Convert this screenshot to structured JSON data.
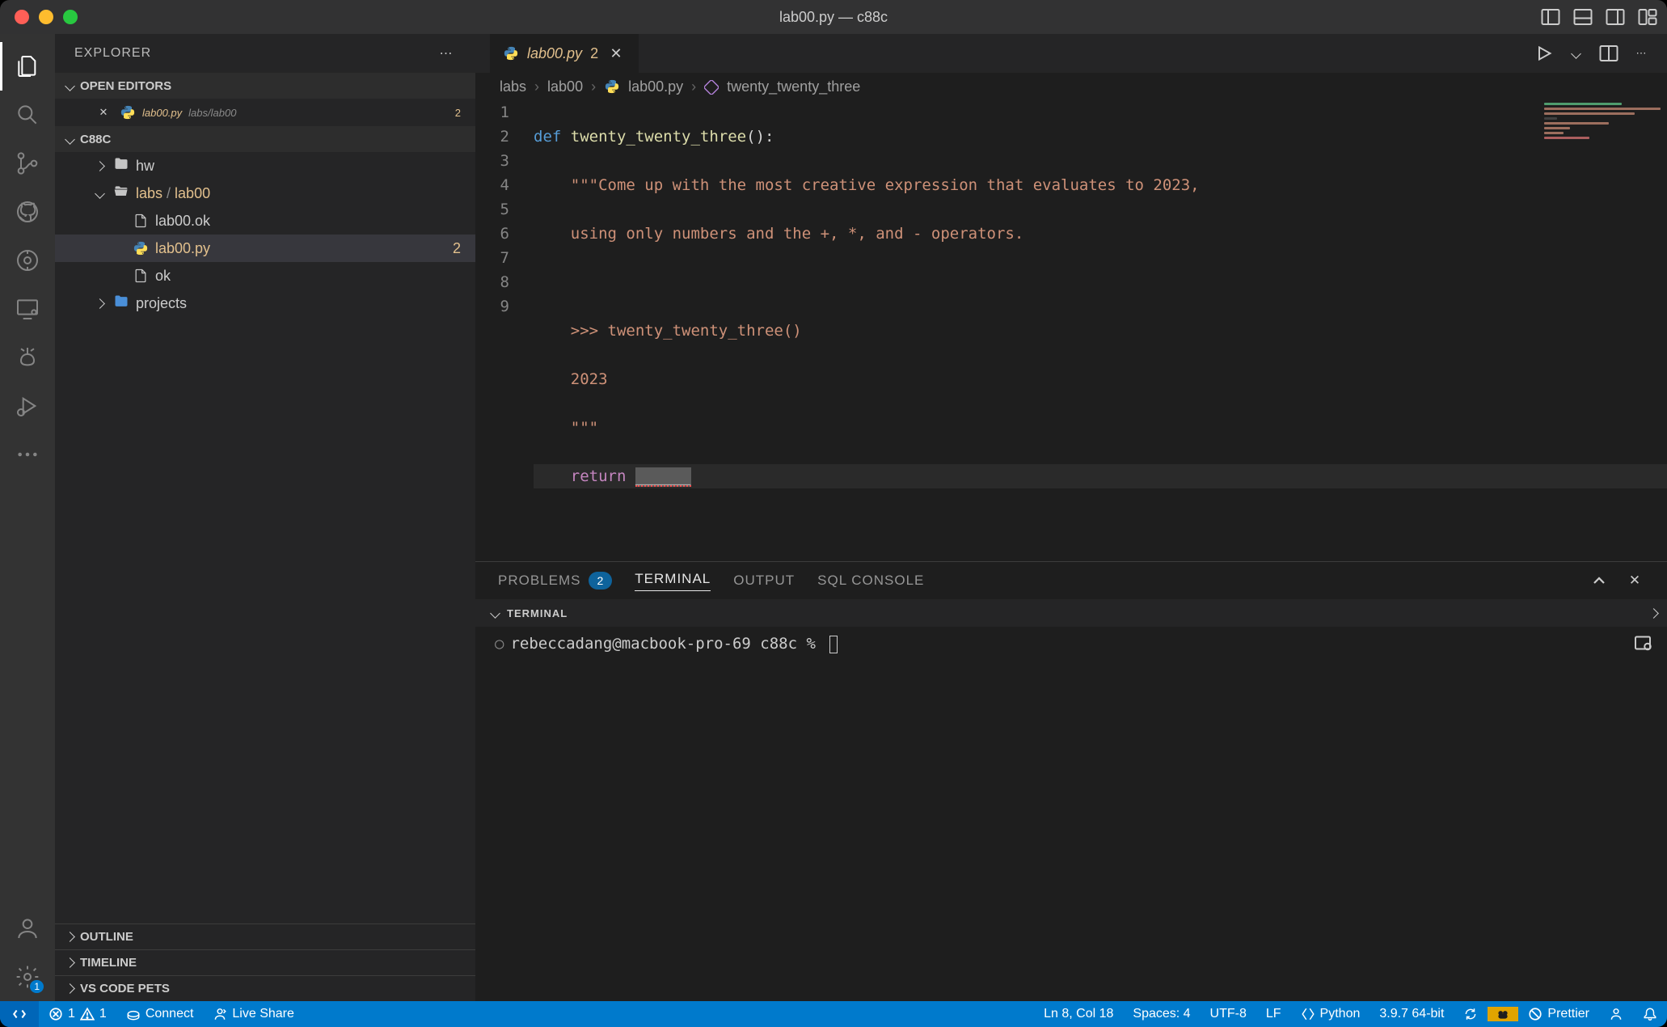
{
  "window": {
    "title": "lab00.py — c88c"
  },
  "sidebar": {
    "title": "EXPLORER",
    "open_editors_label": "OPEN EDITORS",
    "workspace_label": "C88C",
    "outline_label": "OUTLINE",
    "timeline_label": "TIMELINE",
    "pets_label": "VS CODE PETS",
    "open_editors": [
      {
        "name": "lab00.py",
        "path": "labs/lab00",
        "problems": "2"
      }
    ],
    "tree": {
      "hw": "hw",
      "labs": "labs",
      "lab00": "lab00",
      "lab00_ok": "lab00.ok",
      "lab00_py": "lab00.py",
      "lab00_py_problems": "2",
      "ok": "ok",
      "projects": "projects"
    }
  },
  "tab": {
    "name": "lab00.py",
    "problems": "2"
  },
  "breadcrumbs": {
    "p0": "labs",
    "p1": "lab00",
    "p2": "lab00.py",
    "p3": "twenty_twenty_three"
  },
  "code": {
    "lines": [
      "1",
      "2",
      "3",
      "4",
      "5",
      "6",
      "7",
      "8",
      "9"
    ],
    "l1_def": "def",
    "l1_fn": "twenty_twenty_three",
    "l1_paren": "():",
    "l2": "    \"\"\"Come up with the most creative expression that evaluates to 2023,",
    "l3": "    using only numbers and the +, *, and - operators.",
    "l4": "",
    "l5": "    >>> twenty_twenty_three()",
    "l6": "    2023",
    "l7": "    \"\"\"",
    "l8_ret": "return",
    "l8_err": "______"
  },
  "panel": {
    "problems": "PROBLEMS",
    "problems_count": "2",
    "terminal": "TERMINAL",
    "output": "OUTPUT",
    "sql": "SQL CONSOLE",
    "terminal_title": "TERMINAL",
    "prompt": "rebeccadang@macbook-pro-69 c88c %"
  },
  "status": {
    "errors": "1",
    "warnings": "1",
    "connect": "Connect",
    "live_share": "Live Share",
    "ln_col": "Ln 8, Col 18",
    "spaces": "Spaces: 4",
    "encoding": "UTF-8",
    "eol": "LF",
    "lang": "Python",
    "interp": "3.9.7 64-bit",
    "prettier": "Prettier"
  }
}
